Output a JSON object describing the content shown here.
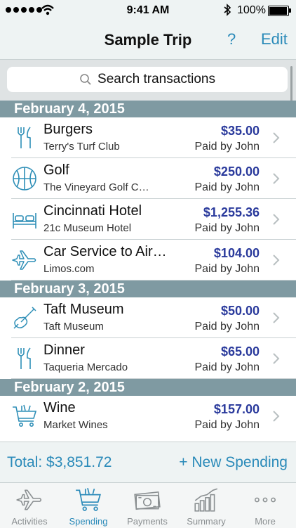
{
  "status_bar": {
    "time": "9:41 AM",
    "battery": "100%"
  },
  "nav": {
    "title": "Sample Trip",
    "help": "?",
    "edit": "Edit"
  },
  "search": {
    "placeholder": "Search transactions"
  },
  "sections": [
    {
      "date": "February 4, 2015",
      "items": [
        {
          "icon": "fork-knife-icon",
          "name": "Burgers",
          "vendor": "Terry's Turf Club",
          "amount": "$35.00",
          "paid_by": "Paid by John"
        },
        {
          "icon": "basketball-icon",
          "name": "Golf",
          "vendor": "The Vineyard Golf C…",
          "amount": "$250.00",
          "paid_by": "Paid by John"
        },
        {
          "icon": "bed-icon",
          "name": "Cincinnati Hotel",
          "vendor": "21c Museum Hotel",
          "amount": "$1,255.36",
          "paid_by": "Paid by John"
        },
        {
          "icon": "airplane-icon",
          "name": "Car Service to Air…",
          "vendor": "Limos.com",
          "amount": "$104.00",
          "paid_by": "Paid by John"
        }
      ]
    },
    {
      "date": "February 3, 2015",
      "items": [
        {
          "icon": "violin-icon",
          "name": "Taft Museum",
          "vendor": "Taft Museum",
          "amount": "$50.00",
          "paid_by": "Paid by John"
        },
        {
          "icon": "fork-knife-icon",
          "name": "Dinner",
          "vendor": "Taqueria Mercado",
          "amount": "$65.00",
          "paid_by": "Paid by John"
        }
      ]
    },
    {
      "date": "February 2, 2015",
      "items": [
        {
          "icon": "shopping-cart-icon",
          "name": "Wine",
          "vendor": "Market Wines",
          "amount": "$157.00",
          "paid_by": "Paid by John"
        }
      ]
    }
  ],
  "footer": {
    "total": "Total: $3,851.72",
    "new_spending": "+ New Spending"
  },
  "tabs": [
    {
      "label": "Activities",
      "icon": "airplane-icon",
      "active": false
    },
    {
      "label": "Spending",
      "icon": "shopping-cart-icon",
      "active": true
    },
    {
      "label": "Payments",
      "icon": "money-icon",
      "active": false
    },
    {
      "label": "Summary",
      "icon": "chart-icon",
      "active": false
    },
    {
      "label": "More",
      "icon": "more-icon",
      "active": false
    }
  ],
  "colors": {
    "accent": "#2a8ab9",
    "amount": "#2a3a9c",
    "section_header": "#7f9aa2"
  }
}
